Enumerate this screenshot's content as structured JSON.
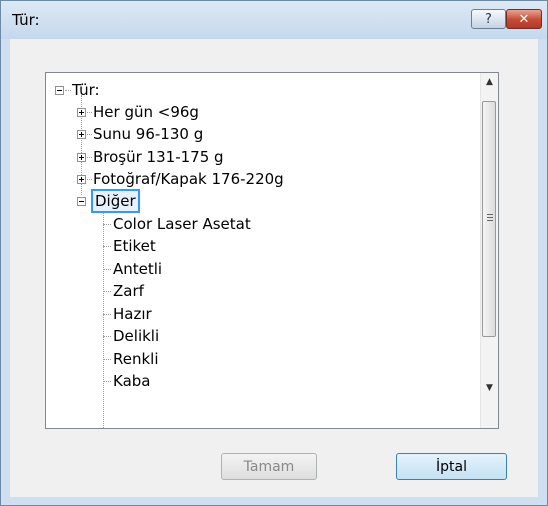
{
  "window": {
    "title": "Tür:"
  },
  "buttons": {
    "help": "?",
    "close": "✕",
    "ok": "Tamam",
    "cancel": "İptal"
  },
  "tree": {
    "root": "Tür:",
    "collapsed_groups": [
      "Her gün <96g",
      "Sunu 96-130 g",
      "Broşür 131-175 g",
      "Fotoğraf/Kapak 176-220g"
    ],
    "expanded_group": {
      "label": "Diğer",
      "children": [
        "Color Laser Asetat",
        "Etiket",
        "Antetli",
        "Zarf",
        "Hazır",
        "Delikli",
        "Renkli",
        "Kaba"
      ]
    }
  },
  "scrollbar": {
    "up_arrow": "▲",
    "down_arrow": "▼"
  }
}
